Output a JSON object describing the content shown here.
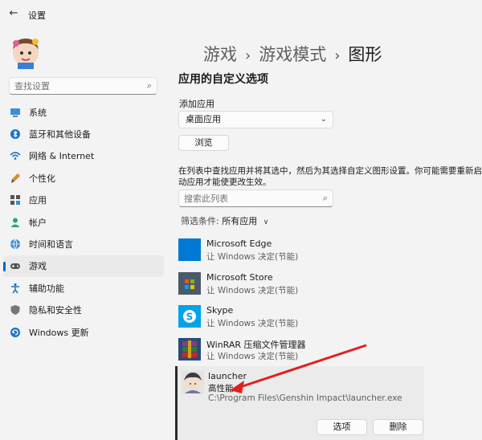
{
  "window": {
    "title": "设置"
  },
  "sidebar": {
    "search_placeholder": "查找设置",
    "items": [
      {
        "label": "系统",
        "icon": "monitor-icon",
        "active": false
      },
      {
        "label": "蓝牙和其他设备",
        "icon": "bluetooth-icon",
        "active": false
      },
      {
        "label": "网络 & Internet",
        "icon": "wifi-icon",
        "active": false
      },
      {
        "label": "个性化",
        "icon": "brush-icon",
        "active": false
      },
      {
        "label": "应用",
        "icon": "apps-icon",
        "active": false
      },
      {
        "label": "帐户",
        "icon": "person-icon",
        "active": false
      },
      {
        "label": "时间和语言",
        "icon": "globe-clock-icon",
        "active": false
      },
      {
        "label": "游戏",
        "icon": "gamepad-icon",
        "active": true
      },
      {
        "label": "辅助功能",
        "icon": "accessibility-icon",
        "active": false
      },
      {
        "label": "隐私和安全性",
        "icon": "shield-icon",
        "active": false
      },
      {
        "label": "Windows 更新",
        "icon": "update-icon",
        "active": false
      }
    ]
  },
  "breadcrumb": {
    "part1": "游戏",
    "sep": "›",
    "part2": "游戏模式",
    "part3": "图形"
  },
  "main": {
    "section_title": "应用的自定义选项",
    "add_app_label": "添加应用",
    "dropdown_value": "桌面应用",
    "browse_label": "浏览",
    "instruction": "在列表中查找应用并将其选中，然后为其选择自定义图形设置。你可能需要重新启动应用才能使更改生效。",
    "list_search_placeholder": "搜索此列表",
    "filter_label": "筛选条件:",
    "filter_value": "所有应用"
  },
  "apps": [
    {
      "name": "Microsoft Edge",
      "pref": "让 Windows 决定(节能)",
      "icon": "edge-icon"
    },
    {
      "name": "Microsoft Store",
      "pref": "让 Windows 决定(节能)",
      "icon": "store-icon"
    },
    {
      "name": "Skype",
      "pref": "让 Windows 决定(节能)",
      "icon": "skype-icon"
    },
    {
      "name": "WinRAR 压缩文件管理器",
      "pref": "让 Windows 决定(节能)",
      "icon": "winrar-icon"
    }
  ],
  "selected_app": {
    "name": "launcher",
    "pref": "高性能",
    "path": "C:\\Program Files\\Genshin Impact\\launcher.exe",
    "options_label": "选项",
    "delete_label": "删除",
    "icon": "genshin-character-icon"
  },
  "colors": {
    "accent": "#0067c0",
    "arrow": "#e02020"
  }
}
